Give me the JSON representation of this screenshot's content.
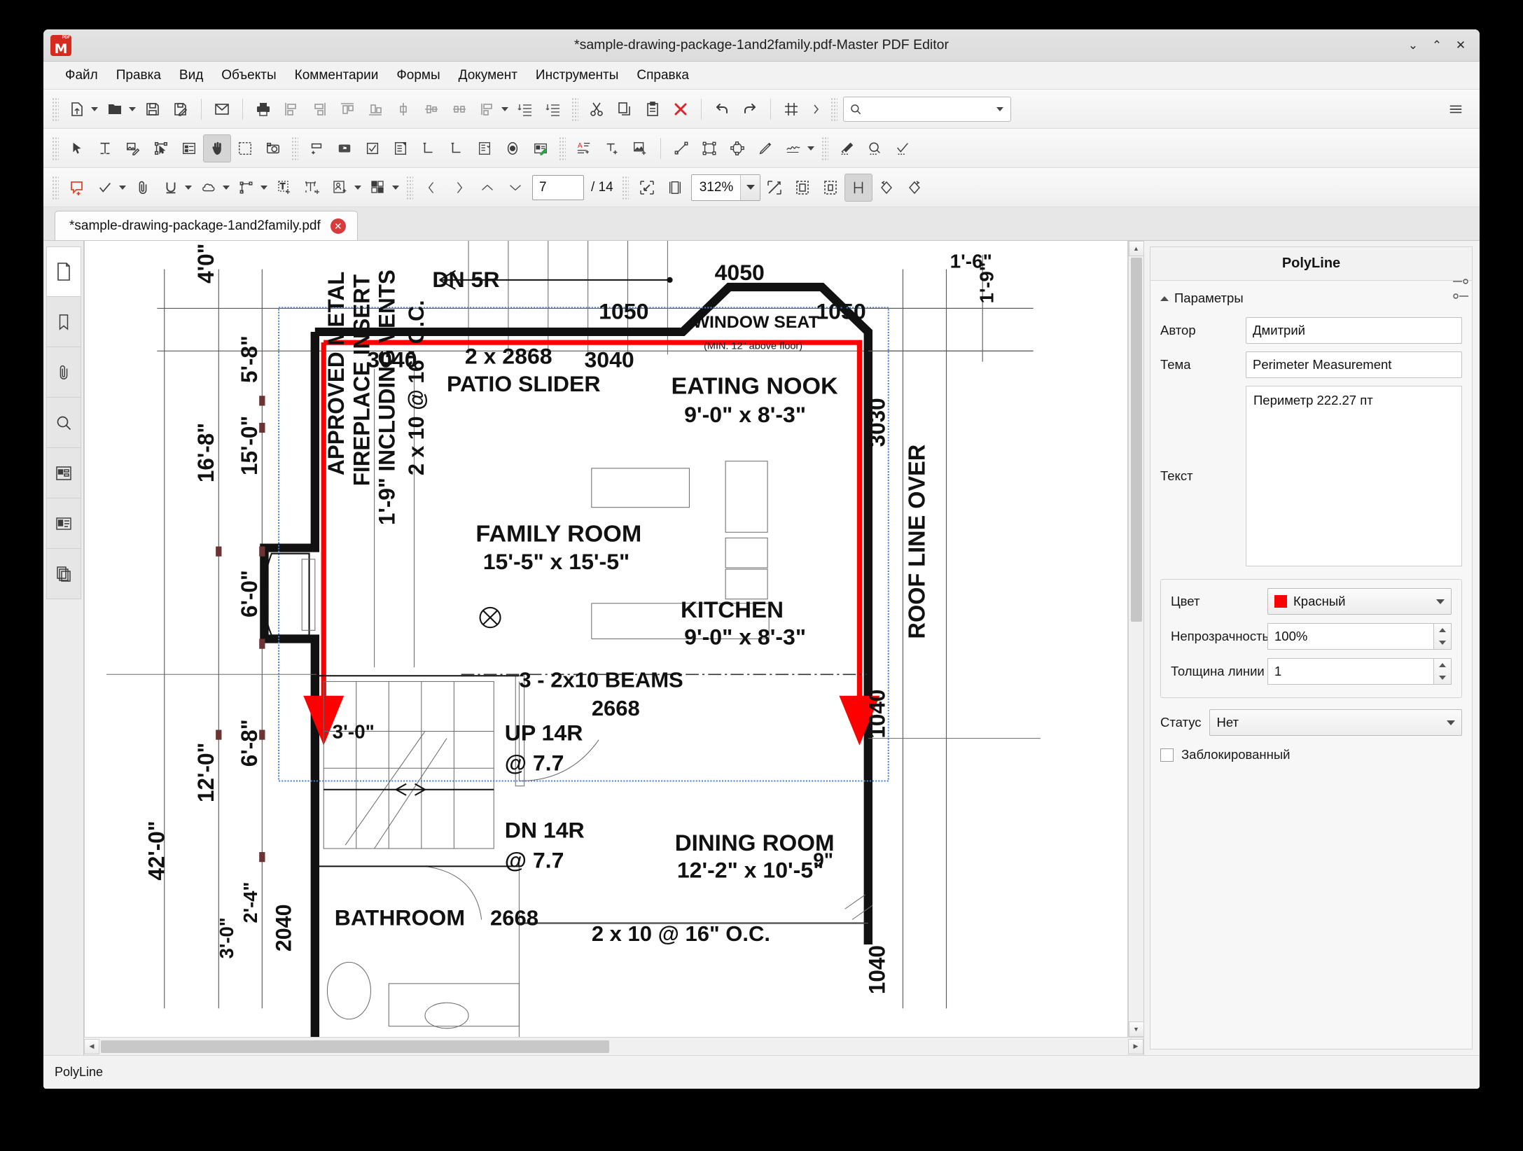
{
  "window": {
    "title": "*sample-drawing-package-1and2family.pdf-Master PDF Editor",
    "minimize": "⌄",
    "maximize": "⌃",
    "close": "✕"
  },
  "menu": [
    "Файл",
    "Правка",
    "Вид",
    "Объекты",
    "Комментарии",
    "Формы",
    "Документ",
    "Инструменты",
    "Справка"
  ],
  "toolbar_main": {
    "icons": [
      "new-document-icon",
      "open-folder-icon",
      "save-icon",
      "save-as-icon",
      "email-icon",
      "print-icon",
      "align-left-icon",
      "align-right-icon",
      "align-top-icon",
      "align-bottom-icon",
      "align-center-vertical-icon",
      "align-center-horizontal-icon",
      "distribute-icon",
      "indent-decrease-icon",
      "indent-increase-icon",
      "cut-icon",
      "copy-icon",
      "paste-icon",
      "delete-icon",
      "undo-icon",
      "redo-icon",
      "grid-icon",
      "overflow-icon",
      "menu-icon"
    ],
    "search_placeholder": ""
  },
  "toolbar_tools": {
    "icons": [
      "select-arrow-icon",
      "edit-text-icon",
      "edit-image-icon",
      "edit-object-icon",
      "form-icon",
      "hand-tool-icon",
      "select-area-icon",
      "snapshot-icon",
      "link-icon",
      "button-field-icon",
      "checkbox-field-icon",
      "combobox-field-icon",
      "list-field-icon",
      "list-box-icon",
      "radio-button-icon",
      "signature-field-icon",
      "add-text-icon",
      "add-text-box-icon",
      "add-image-icon",
      "line-tool-icon",
      "rectangle-tool-icon",
      "ellipse-tool-icon",
      "pencil-tool-icon",
      "signature-icon",
      "eraser-icon",
      "magnify-icon",
      "check-tool-icon"
    ]
  },
  "toolbar_annot": {
    "icons": [
      "sticky-note-icon",
      "check-stamp-icon",
      "attachment-icon",
      "underline-icon",
      "cloud-icon",
      "polyline-icon",
      "text-markup-icon",
      "text-stamp-icon",
      "stamp-person-icon",
      "stamp-grid-icon",
      "prev-page-icon",
      "next-page-icon",
      "page-up-icon",
      "page-down-icon"
    ],
    "page_current": "7",
    "page_total": "/ 14",
    "zoom_value": "312%",
    "zoom_icons": [
      "zoom-out-fit-icon",
      "fit-page-icon",
      "fit-width-icon",
      "fit-visible-icon",
      "actual-size-icon",
      "single-page-icon",
      "rotate-left-icon",
      "rotate-right-icon"
    ]
  },
  "tab": {
    "label": "*sample-drawing-package-1and2family.pdf",
    "close": "✕"
  },
  "left_rail": [
    "page-thumbnail-icon",
    "bookmark-icon",
    "attachment-icon",
    "search-icon",
    "layers-icon",
    "signature-panel-icon",
    "pages-panel-icon"
  ],
  "panel": {
    "title": "PolyLine",
    "group_label": "Параметры",
    "fields": {
      "author_label": "Автор",
      "author_value": "Дмитрий",
      "subject_label": "Тема",
      "subject_value": "Perimeter Measurement",
      "text_label": "Текст",
      "text_value": "Периметр 222.27 пт",
      "color_label": "Цвет",
      "color_value": "Красный",
      "color_hex": "#ff0000",
      "opacity_label": "Непрозрачность",
      "opacity_value": "100%",
      "linewidth_label": "Толщина линии",
      "linewidth_value": "1",
      "status_label": "Статус",
      "status_value": "Нет",
      "locked_label": "Заблокированный"
    },
    "tool_icons": [
      "collapse-panel-icon",
      "expand-panel-icon"
    ]
  },
  "statusbar": {
    "text": "PolyLine"
  },
  "drawing": {
    "rooms": [
      {
        "name": "FAMILY ROOM",
        "size": "15'-5\" x 15'-5\""
      },
      {
        "name": "EATING NOOK",
        "size": "9'-0\" x 8'-3\""
      },
      {
        "name": "KITCHEN",
        "size": "9'-0\" x 8'-3\""
      },
      {
        "name": "DINING ROOM",
        "size": "12'-2\" x 10'-5\""
      },
      {
        "name": "BATHROOM",
        "size": ""
      }
    ],
    "labels": [
      "DN 5R",
      "4050",
      "1050",
      "1050",
      "WINDOW SEAT",
      "(MIN. 12\" above floor)",
      "3040",
      "2 x 2868",
      "3040",
      "PATIO SLIDER",
      "APPROVED METAL",
      "FIREPLACE INSERT",
      "1'-9\" INCLUDING VENTS",
      "2 x 10 @ 16\" O.C.",
      "ROOF LINE OVER",
      "3030",
      "1040",
      "3 - 2x10 BEAMS",
      "2668",
      "UP 14R",
      "@ 7.7",
      "DN 14R",
      "@ 7.7",
      "2668",
      "2 x 10 @ 16\" O.C.",
      "2040",
      "3'-0\"",
      "9\"",
      "1'-6\"",
      "1'-9\""
    ],
    "dimensions_left": [
      "4'0\"",
      "5'-8\"",
      "16'-8\"",
      "15'-0\"",
      "6'-0\"",
      "6'-8\"",
      "12'-0\"",
      "42'-0\"",
      "2'-4\"",
      "3'-0\"",
      "3'-0\""
    ],
    "annotation_color": "#ff0000"
  }
}
